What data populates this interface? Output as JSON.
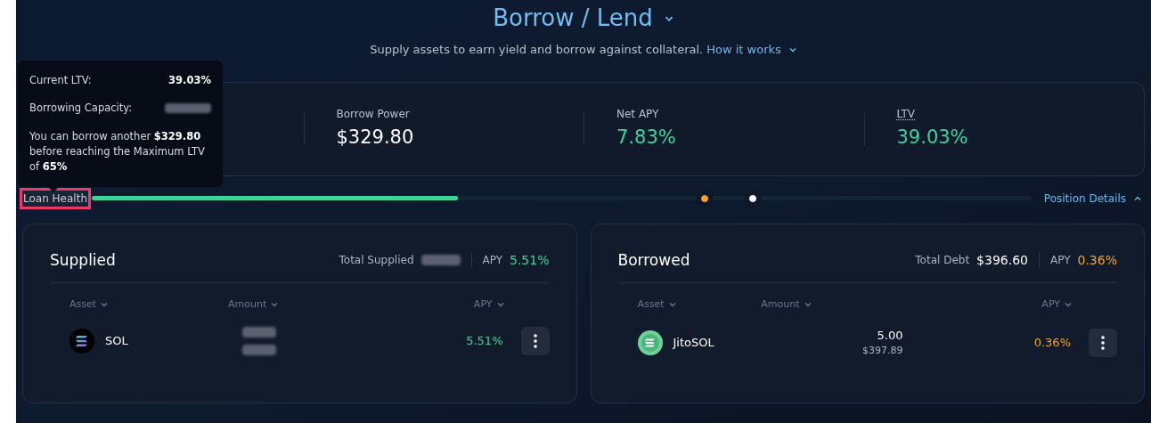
{
  "header": {
    "title": "Borrow / Lend",
    "subtitle": "Supply assets to earn yield and borrow against collateral.",
    "link": "How it works"
  },
  "tooltip": {
    "rows": [
      {
        "label": "Current LTV:",
        "value": "39.03%",
        "redacted": false
      },
      {
        "label": "Borrowing Capacity:",
        "redacted": true
      }
    ],
    "note": "You can borrow another **$329.80** before reaching the Maximum LTV of **65%**"
  },
  "stats": [
    {
      "label": "Borrow Power",
      "value": "$329.80",
      "color": "#ffffff",
      "underlined": false
    },
    {
      "label": "Net APY",
      "value": "7.83%",
      "color": "#3dd49b",
      "underlined": false
    },
    {
      "label": "LTV",
      "value": "39.03%",
      "color": "#3dd49b",
      "underlined": true
    }
  ],
  "loan_health": {
    "label": "Loan Health",
    "highlighted": true,
    "level": 0.39,
    "markers": [
      {
        "level": 0.652,
        "color": "#f5a524"
      },
      {
        "level": 0.703,
        "color": "#ffffff"
      }
    ],
    "details_link": "Position Details",
    "expanded": true
  },
  "panels": [
    {
      "title": "Supplied",
      "total_label": "Total Supplied",
      "total_redacted": true,
      "apy_label": "APY",
      "apy": "5.51%",
      "color": "#3dd49b",
      "columns": [
        "Asset",
        "Amount",
        "APY"
      ],
      "rows": [
        {
          "asset": "SOL",
          "kind": "sol",
          "amount_redacted": true,
          "apy": "5.51%"
        }
      ]
    },
    {
      "title": "Borrowed",
      "total_label": "Total Debt",
      "total_value": "$396.60",
      "total_redacted": false,
      "apy_label": "APY",
      "apy": "0.36%",
      "color": "#f5a524",
      "columns": [
        "Asset",
        "Amount",
        "APY"
      ],
      "rows": [
        {
          "asset": "JitoSOL",
          "kind": "jitosol",
          "amount_redacted": false,
          "amount": "5.00",
          "amount_usd": "$397.89",
          "apy": "0.36%"
        }
      ]
    }
  ]
}
